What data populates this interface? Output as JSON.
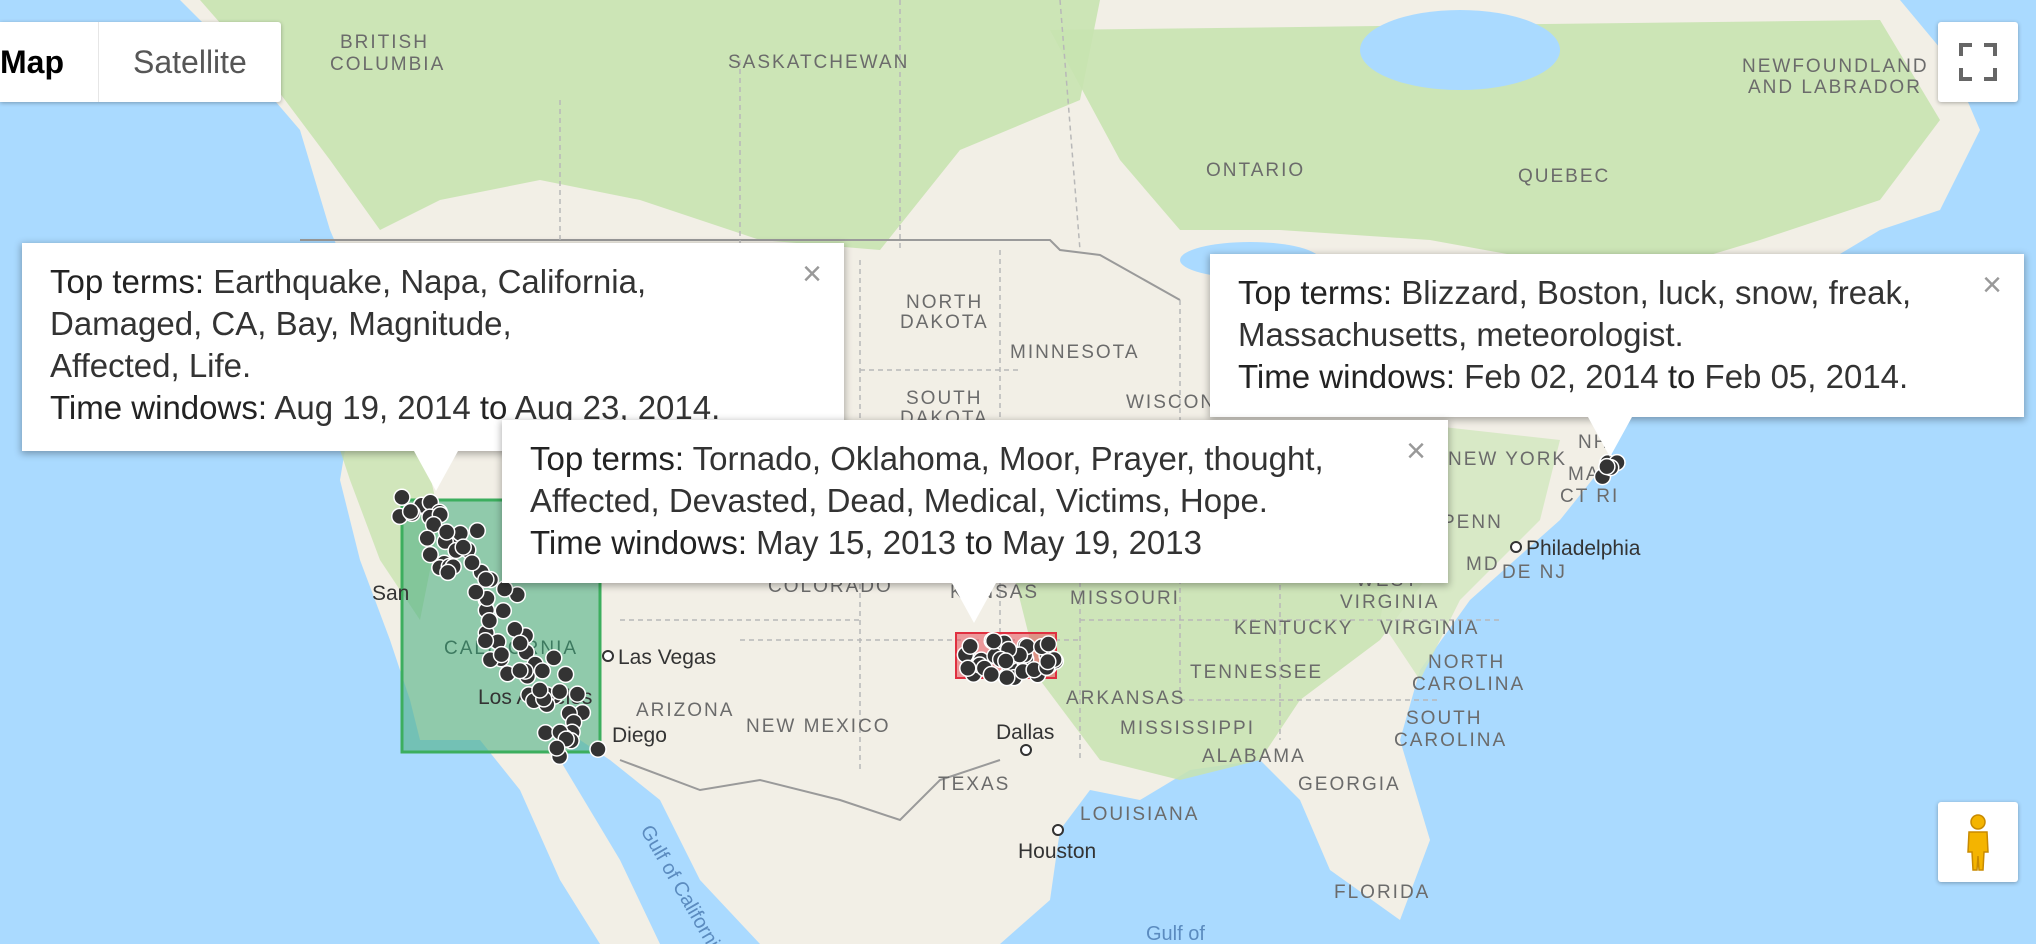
{
  "map_type": {
    "map_label": "Map",
    "satellite_label": "Satellite"
  },
  "labels": {
    "british_columbia_1": "BRITISH",
    "british_columbia_2": "COLUMBIA",
    "saskatchewan": "SASKATCHEWAN",
    "newfoundland_1": "NEWFOUNDLAND",
    "newfoundland_2": "AND LABRADOR",
    "ontario": "ONTARIO",
    "quebec": "QUEBEC",
    "north_dakota_1": "NORTH",
    "north_dakota_2": "DAKOTA",
    "minnesota": "MINNESOTA",
    "south_dakota_1": "SOUTH",
    "south_dakota_2": "DAKOTA",
    "wisconsin": "WISCON",
    "new_york": "NEW YORK",
    "nh": "NH",
    "ma": "MA",
    "ct_ri": "CT RI",
    "penn": "PENN",
    "philadelphia": "Philadelphia",
    "md": "MD",
    "de_nj": "DE NJ",
    "colorado": "COLORADO",
    "kansas": "KANSAS",
    "missouri": "MISSOURI",
    "west_virginia_1": "WEST",
    "west_virginia_2": "VIRGINIA",
    "kentucky": "KENTUCKY",
    "virginia": "VIRGINIA",
    "tennessee": "TENNESSEE",
    "north_carolina_1": "NORTH",
    "north_carolina_2": "CAROLINA",
    "south_carolina_1": "SOUTH",
    "south_carolina_2": "CAROLINA",
    "arkansas": "ARKANSAS",
    "mississippi": "MISSISSIPPI",
    "alabama": "ALABAMA",
    "georgia": "GEORGIA",
    "louisiana": "LOUISIANA",
    "florida": "FLORIDA",
    "arizona": "ARIZONA",
    "new_mexico": "NEW MEXICO",
    "texas": "TEXAS",
    "las_vegas": "Las Vegas",
    "san_diego": "Diego",
    "san_francisco": "San",
    "los_angeles": "Los Angeles",
    "california": "CALIFORNIA",
    "dallas": "Dallas",
    "houston": "Houston",
    "gulf_california": "Gulf of California",
    "gulf_mexico": "Gulf of"
  },
  "info_windows": [
    {
      "terms_label": "Top terms:",
      "terms_line1": "Earthquake, Napa, California,",
      "terms_line2": "Damaged, CA, Bay, Magnitude,",
      "terms_line3": "Affected, Life.",
      "time_label": "Time windows:",
      "time_start": "Aug 19, 2014",
      "to": "to",
      "time_end": "Aug 23, 2014.",
      "close": "×"
    },
    {
      "terms_label": "Top terms:",
      "terms_line1": "Tornado, Oklahoma, Moor, Prayer, thought,",
      "terms_line2": "Affected, Devasted, Dead, Medical, Victims, Hope.",
      "time_label": "Time windows:",
      "time_start": "May 15, 2013",
      "to": "to",
      "time_end": "May 19, 2013",
      "close": "×"
    },
    {
      "terms_label": "Top terms:",
      "terms_line1": "Blizzard, Boston, luck, snow, freak,",
      "terms_line2": "Massachusetts, meteorologist.",
      "time_label": "Time windows:",
      "time_start": "Feb 02, 2014",
      "to": "to",
      "time_end": "Feb 05, 2014.",
      "close": "×"
    }
  ],
  "colors": {
    "water": "#aadaff",
    "land": "#f2efe6",
    "vegetation": "#c8e3b0",
    "california_region": "#4fb083",
    "oklahoma_region": "#e8505b",
    "marker": "#333333"
  },
  "icons": {
    "fullscreen": "fullscreen-icon",
    "pegman": "pegman-icon"
  }
}
